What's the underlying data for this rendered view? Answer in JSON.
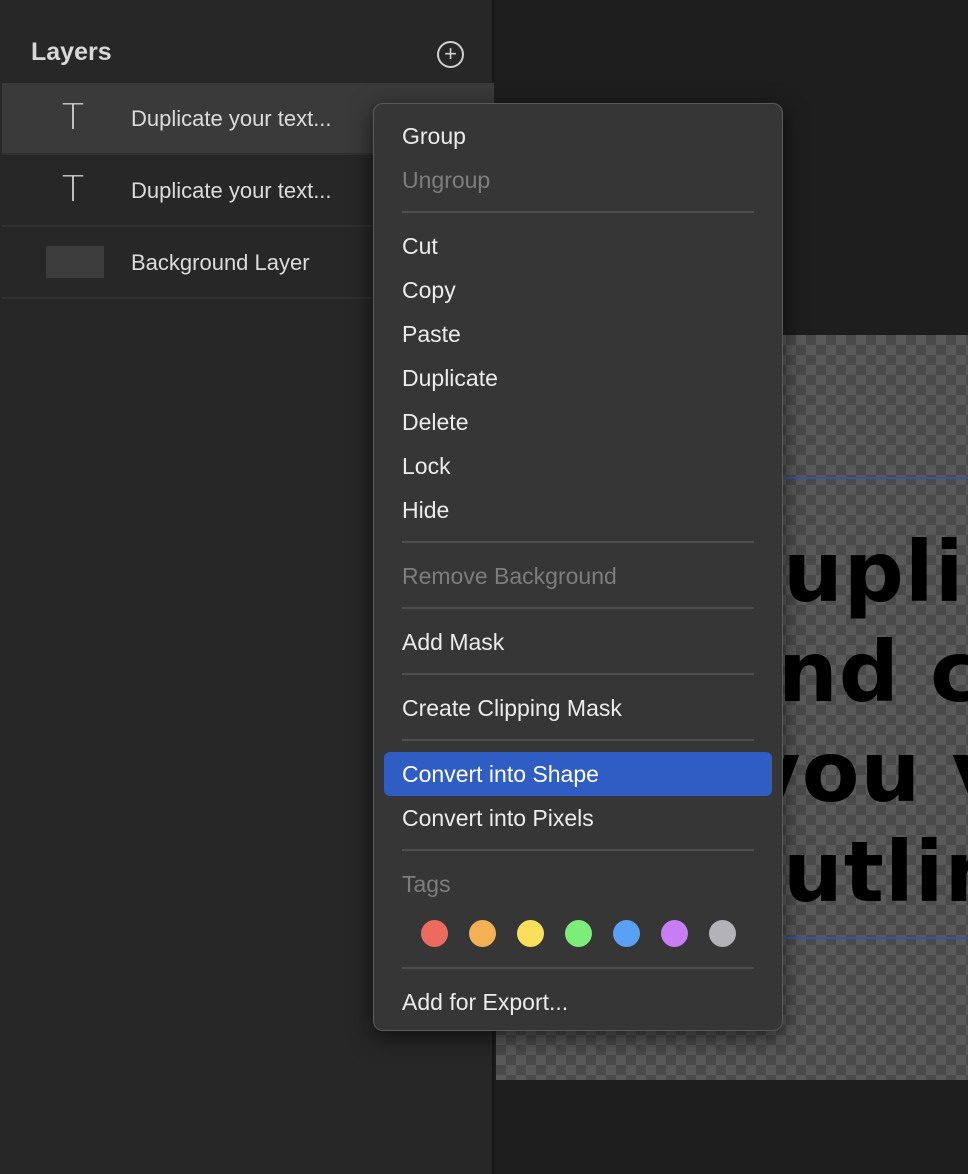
{
  "layers_panel": {
    "title": "Layers",
    "add_icon": "plus-circle-icon",
    "layers": [
      {
        "icon": "text-icon",
        "name": "Duplicate your text...",
        "selected": true
      },
      {
        "icon": "text-icon",
        "name": "Duplicate your text...",
        "selected": false
      },
      {
        "icon": "thumbnail",
        "name": "Background Layer",
        "selected": false
      }
    ]
  },
  "canvas": {
    "text_lines": [
      "uplic",
      "nd co",
      "you v",
      "utlin"
    ]
  },
  "context_menu": {
    "items": [
      {
        "label": "Group",
        "enabled": true
      },
      {
        "label": "Ungroup",
        "enabled": false
      },
      {
        "label": "Cut",
        "enabled": true
      },
      {
        "label": "Copy",
        "enabled": true
      },
      {
        "label": "Paste",
        "enabled": true
      },
      {
        "label": "Duplicate",
        "enabled": true
      },
      {
        "label": "Delete",
        "enabled": true
      },
      {
        "label": "Lock",
        "enabled": true
      },
      {
        "label": "Hide",
        "enabled": true
      },
      {
        "label": "Remove Background",
        "enabled": false
      },
      {
        "label": "Add Mask",
        "enabled": true
      },
      {
        "label": "Create Clipping Mask",
        "enabled": true
      },
      {
        "label": "Convert into Shape",
        "enabled": true,
        "highlighted": true
      },
      {
        "label": "Convert into Pixels",
        "enabled": true
      },
      {
        "label": "Tags",
        "enabled": false
      },
      {
        "label": "Add for Export...",
        "enabled": true
      }
    ],
    "tag_colors": [
      "#ec6a5e",
      "#f4b054",
      "#f9df5c",
      "#7ded7a",
      "#5aa1f5",
      "#c77ef4",
      "#b3b3b7"
    ]
  }
}
